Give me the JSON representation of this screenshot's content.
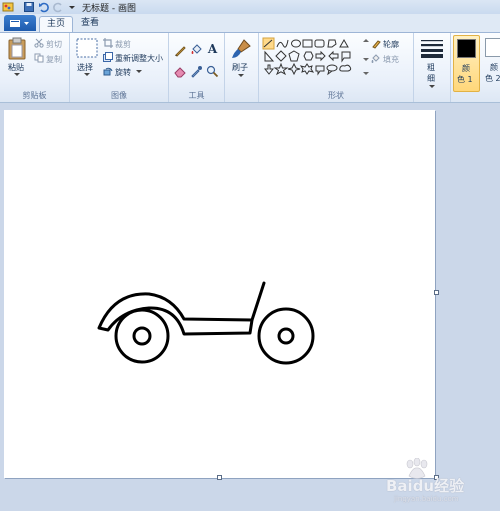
{
  "titlebar": {
    "title": "无标题 - 画图"
  },
  "tabs": [
    {
      "label": "主页"
    },
    {
      "label": "查看"
    }
  ],
  "clipboard": {
    "paste": "粘贴",
    "cut": "剪切",
    "copy": "复制",
    "group_label": "剪贴板"
  },
  "image": {
    "select": "选择",
    "crop": "裁剪",
    "resize": "重新调整大小",
    "rotate": "旋转",
    "group_label": "图像"
  },
  "tools": {
    "text_glyph": "A",
    "group_label": "工具"
  },
  "brushes": {
    "label": "刷子"
  },
  "shapes": {
    "outline": "轮廓",
    "fill": "填充",
    "group_label": "形状"
  },
  "size": {
    "label_line1": "粗",
    "label_line2": "细"
  },
  "colors": {
    "color1_line1": "颜",
    "color1_line2": "色 1",
    "color2_line1": "颜",
    "color2_line2": "色 2",
    "color1_value": "#000000",
    "color2_value": "#ffffff"
  },
  "watermark": {
    "text": "Baidu经验",
    "sub": "jingyan.baidu.com"
  }
}
